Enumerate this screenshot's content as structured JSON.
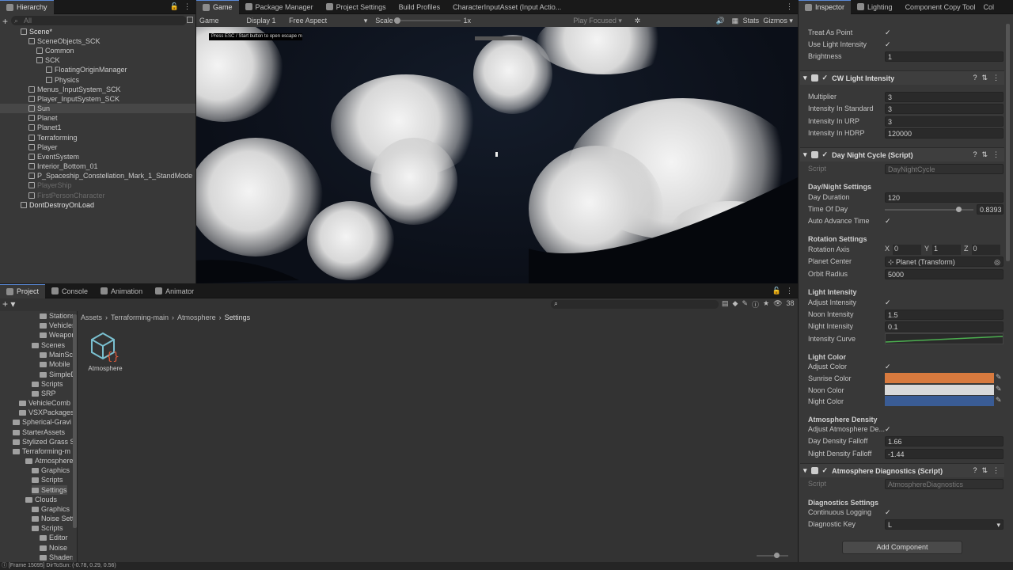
{
  "hierarchy": {
    "tab": "Hierarchy",
    "search_placeholder": "All",
    "items": [
      {
        "label": "Scene*"
      },
      {
        "label": "SceneObjects_SCK"
      },
      {
        "label": "Common"
      },
      {
        "label": "SCK"
      },
      {
        "label": "FloatingOriginManager"
      },
      {
        "label": "Physics"
      },
      {
        "label": "Menus_InputSystem_SCK"
      },
      {
        "label": "Player_InputSystem_SCK"
      },
      {
        "label": "Sun"
      },
      {
        "label": "Planet"
      },
      {
        "label": "Planet1"
      },
      {
        "label": "Terraforming"
      },
      {
        "label": "Player"
      },
      {
        "label": "EventSystem"
      },
      {
        "label": "Interior_Bottom_01"
      },
      {
        "label": "P_Spaceship_Constellation_Mark_1_StandMode"
      },
      {
        "label": "PlayerShip"
      },
      {
        "label": "FirstPersonCharacter"
      },
      {
        "label": "DontDestroyOnLoad"
      }
    ]
  },
  "center_tabs": [
    "Game",
    "Package Manager",
    "Project Settings",
    "Build Profiles",
    "CharacterInputAsset (Input Actio..."
  ],
  "game_toolbar": {
    "mode": "Game",
    "display": "Display 1",
    "aspect": "Free Aspect",
    "scale_label": "Scale",
    "scale_value": "1x",
    "play_focused": "Play Focused",
    "stats": "Stats",
    "gizmos": "Gizmos"
  },
  "viewport": {
    "hint": "Press ESC / Start button to open escape menu"
  },
  "bottom_tabs": [
    "Project",
    "Console",
    "Animation",
    "Animator"
  ],
  "project": {
    "breadcrumb": [
      "Assets",
      "Terraforming-main",
      "Atmosphere",
      "Settings"
    ],
    "visible_count": "38",
    "asset_label": "Atmosphere",
    "tree": [
      {
        "label": "Stations"
      },
      {
        "label": "Vehicles"
      },
      {
        "label": "Weapon"
      },
      {
        "label": "Scenes"
      },
      {
        "label": "MainSce"
      },
      {
        "label": "Mobile"
      },
      {
        "label": "SimpleD"
      },
      {
        "label": "Scripts"
      },
      {
        "label": "SRP"
      },
      {
        "label": "VehicleComb"
      },
      {
        "label": "VSXPackages"
      },
      {
        "label": "Spherical-Gravi"
      },
      {
        "label": "StarterAssets"
      },
      {
        "label": "Stylized Grass S"
      },
      {
        "label": "Terraforming-m"
      },
      {
        "label": "Atmosphere"
      },
      {
        "label": "Graphics"
      },
      {
        "label": "Scripts"
      },
      {
        "label": "Settings"
      },
      {
        "label": "Clouds"
      },
      {
        "label": "Graphics"
      },
      {
        "label": "Noise Settin"
      },
      {
        "label": "Scripts"
      },
      {
        "label": "Editor"
      },
      {
        "label": "Noise"
      },
      {
        "label": "Shaders"
      }
    ]
  },
  "inspector": {
    "tabs": [
      "Inspector",
      "Lighting",
      "Component Copy Tool",
      "Col"
    ],
    "top_rows": [
      {
        "label": "Treat As Point",
        "value": "✓"
      },
      {
        "label": "Use Light Intensity",
        "value": "✓"
      },
      {
        "label": "Brightness",
        "value": "1"
      }
    ],
    "cw_header": "CW Light Intensity",
    "cw_rows": [
      {
        "label": "Multiplier",
        "value": "3"
      },
      {
        "label": "Intensity In Standard",
        "value": "3"
      },
      {
        "label": "Intensity In URP",
        "value": "3"
      },
      {
        "label": "Intensity In HDRP",
        "value": "120000"
      }
    ],
    "dnc_header": "Day Night Cycle (Script)",
    "script_label": "Script",
    "dnc_script": "DayNightCycle",
    "sec_daynight": "Day/Night Settings",
    "day_duration": {
      "label": "Day Duration",
      "value": "120"
    },
    "time_of_day": {
      "label": "Time Of Day",
      "value": "0.8393"
    },
    "auto_advance": {
      "label": "Auto Advance Time",
      "value": "✓"
    },
    "sec_rotation": "Rotation Settings",
    "rotation_axis": {
      "label": "Rotation Axis",
      "x_label": "X",
      "x": "0",
      "y_label": "Y",
      "y": "1",
      "z_label": "Z",
      "z": "0"
    },
    "planet_center": {
      "label": "Planet Center",
      "value": "Planet (Transform)"
    },
    "orbit_radius": {
      "label": "Orbit Radius",
      "value": "5000"
    },
    "sec_light_intensity": "Light Intensity",
    "adjust_intensity": {
      "label": "Adjust Intensity",
      "value": "✓"
    },
    "noon_intensity": {
      "label": "Noon Intensity",
      "value": "1.5"
    },
    "night_intensity": {
      "label": "Night Intensity",
      "value": "0.1"
    },
    "intensity_curve": {
      "label": "Intensity Curve"
    },
    "sec_light_color": "Light Color",
    "adjust_color": {
      "label": "Adjust Color",
      "value": "✓"
    },
    "sunrise_color": {
      "label": "Sunrise Color",
      "color": "#d87a3e"
    },
    "noon_color": {
      "label": "Noon Color",
      "color": "#d9d9d9"
    },
    "night_color": {
      "label": "Night Color",
      "color": "#3a5c95"
    },
    "sec_density": "Atmosphere Density",
    "adjust_density": {
      "label": "Adjust Atmosphere De...",
      "value": "✓"
    },
    "day_density": {
      "label": "Day Density Falloff",
      "value": "1.66"
    },
    "night_density": {
      "label": "Night Density Falloff",
      "value": "-1.44"
    },
    "diag_header": "Atmosphere Diagnostics (Script)",
    "diag_script": "AtmosphereDiagnostics",
    "sec_diag": "Diagnostics Settings",
    "continuous_logging": {
      "label": "Continuous Logging",
      "value": "✓"
    },
    "diagnostic_key": {
      "label": "Diagnostic Key",
      "value": "L"
    },
    "add_component": "Add Component"
  },
  "status": {
    "text": "[Frame 15095] DirToSun: (-0.78, 0.29, 0.56)"
  }
}
